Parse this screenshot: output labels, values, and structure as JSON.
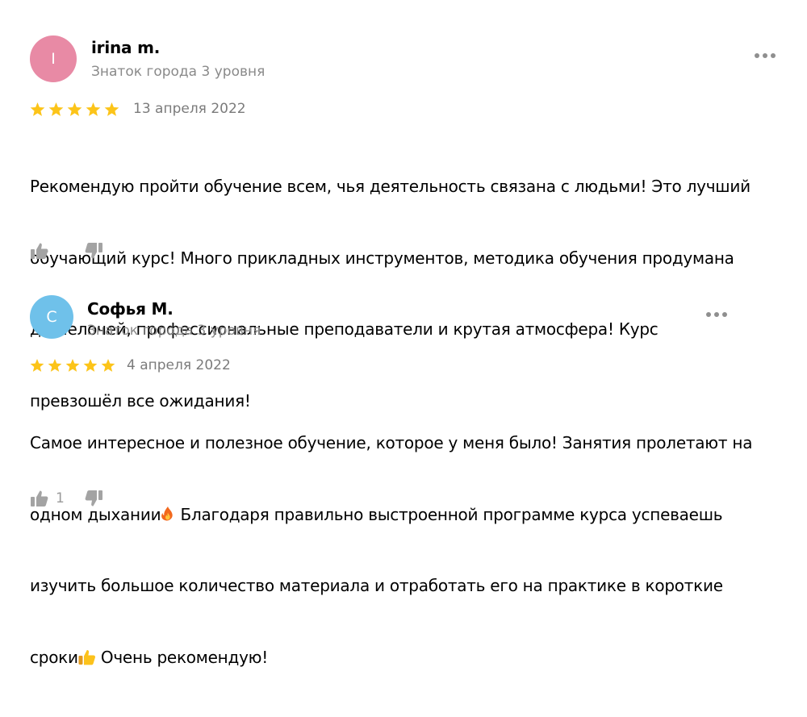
{
  "reviews": [
    {
      "author": "irina m.",
      "avatar_letter": "I",
      "avatar_color": "#e88aa5",
      "level": "Знаток города 3 уровня",
      "rating": 5,
      "date": "13 апреля 2022",
      "text_lines": [
        "Рекомендую пройти обучение всем, чья деятельность связана с людьми! Это лучший",
        "обучающий курс! Много прикладных инструментов, методика обучения продумана",
        "до мелочей, профессиональные преподаватели и крутая атмосфера! Курс",
        "превзошёл все ожидания!"
      ],
      "likes": ""
    },
    {
      "author": "Софья М.",
      "avatar_letter": "С",
      "avatar_color": "#6fc1ea",
      "level": "Знаток города 3 уровня",
      "rating": 5,
      "date": "4 апреля 2022",
      "text_lines": [
        "Самое интересное и полезное обучение, которое у меня было! Занятия пролетают на",
        "одном дыхании",
        " Благодаря правильно выстроенной программе курса успеваешь",
        "изучить большое количество материала и отработать его на практике в короткие",
        "сроки",
        " Очень рекомендую!"
      ],
      "likes": "1"
    }
  ],
  "colors": {
    "star": "#fcc419",
    "icon_gray": "#a3a3a3",
    "muted_text": "#8a8a8a"
  },
  "icons": {
    "emoji_fire": "fire-emoji",
    "emoji_thumbs_up": "thumbs-up-emoji"
  }
}
